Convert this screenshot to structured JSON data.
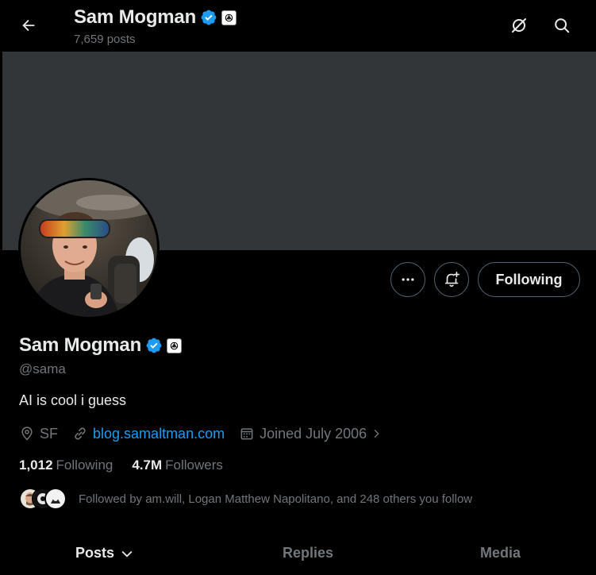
{
  "header": {
    "name": "Sam Mogman",
    "posts_count": "7,659 posts"
  },
  "profile": {
    "name": "Sam Mogman",
    "handle": "@sama",
    "bio": "AI is cool i guess",
    "location": "SF",
    "website": "blog.samaltman.com",
    "joined": "Joined July 2006",
    "following_count": "1,012",
    "following_label": "Following",
    "followers_count": "4.7M",
    "followers_label": "Followers",
    "followed_by": "Followed by am.will, Logan Matthew Napolitano, and 248 others you follow"
  },
  "actions": {
    "following_button": "Following"
  },
  "tabs": [
    {
      "label": "Posts"
    },
    {
      "label": "Replies"
    },
    {
      "label": "Media"
    }
  ],
  "icons": {
    "back": "arrow-left-icon",
    "grok": "grok-icon",
    "search": "search-icon",
    "more": "more-dots-icon",
    "notify": "bell-plus-icon",
    "verified": "verified-badge-icon",
    "affiliate": "openai-logo-icon",
    "location": "location-pin-icon",
    "link": "link-icon",
    "calendar": "calendar-icon"
  },
  "colors": {
    "background": "#000000",
    "banner": "#333639",
    "verified": "#1d9bf0",
    "link": "#1d9bf0",
    "text_primary": "#e7e9ea",
    "text_secondary": "#71767b"
  }
}
